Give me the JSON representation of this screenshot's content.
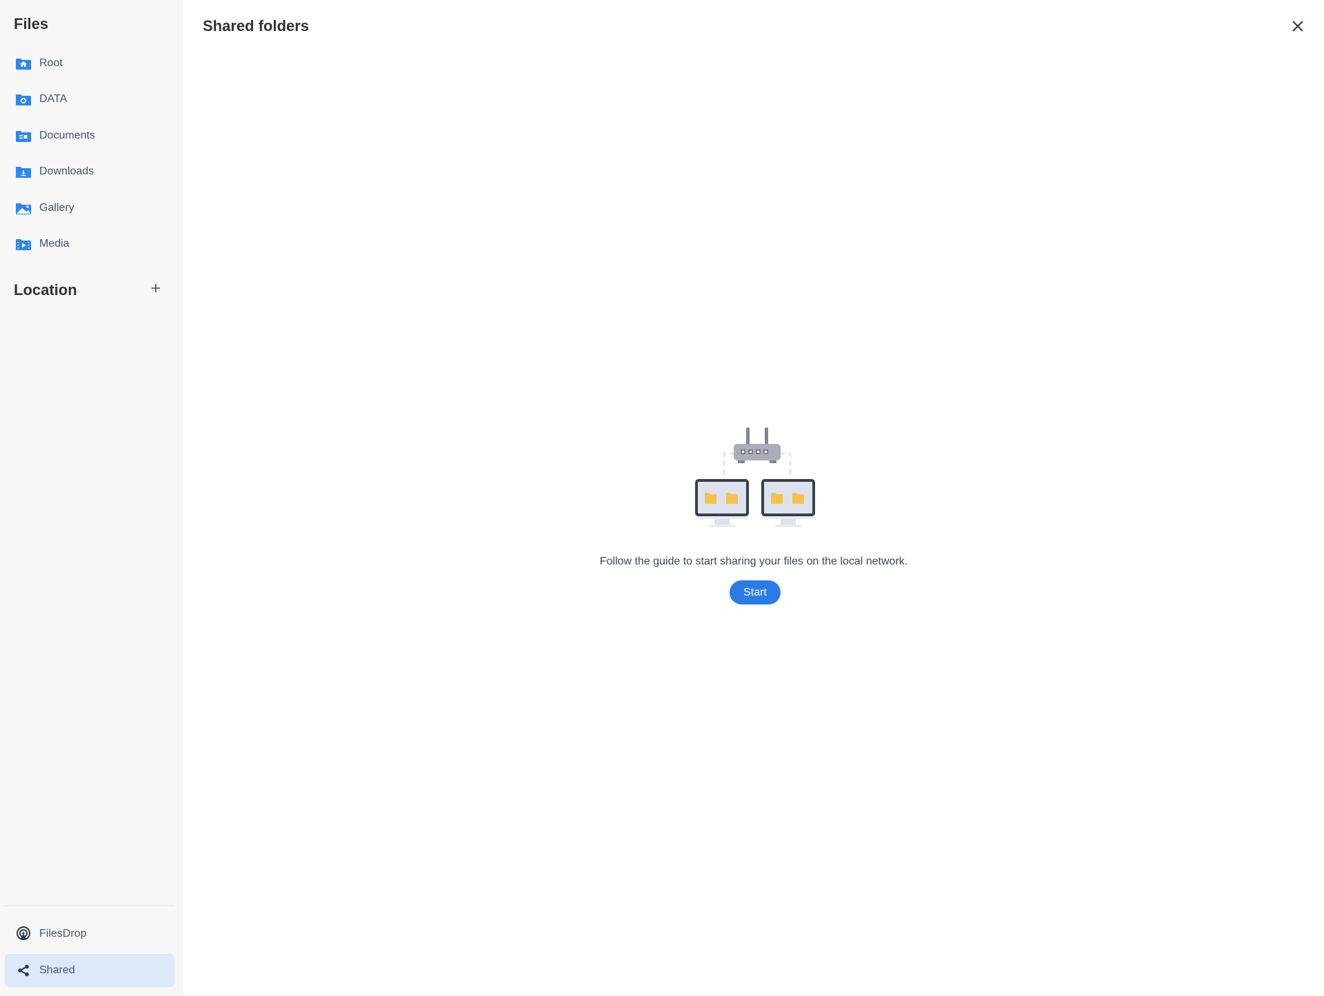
{
  "sidebar": {
    "title": "Files",
    "items": [
      {
        "label": "Root",
        "icon": "folder-home-icon"
      },
      {
        "label": "DATA",
        "icon": "folder-box-icon"
      },
      {
        "label": "Documents",
        "icon": "folder-documents-icon"
      },
      {
        "label": "Downloads",
        "icon": "folder-download-icon"
      },
      {
        "label": "Gallery",
        "icon": "folder-image-icon"
      },
      {
        "label": "Media",
        "icon": "folder-video-icon"
      }
    ],
    "location_title": "Location",
    "location_add_icon": "plus-icon",
    "bottom_items": [
      {
        "label": "FilesDrop",
        "icon": "airdrop-icon"
      },
      {
        "label": "Shared",
        "icon": "share-icon",
        "active": true
      }
    ]
  },
  "main": {
    "title": "Shared folders",
    "close_icon": "close-icon",
    "illustration": "network-sharing-illustration",
    "guide_text": "Follow the guide to start sharing your files on the local network.",
    "start_label": "Start"
  },
  "colors": {
    "accent": "#2a7be6",
    "folder_icon": "#2f86ef",
    "active_bg": "#dde9f9",
    "sidebar_bg": "#f7f7f8"
  }
}
